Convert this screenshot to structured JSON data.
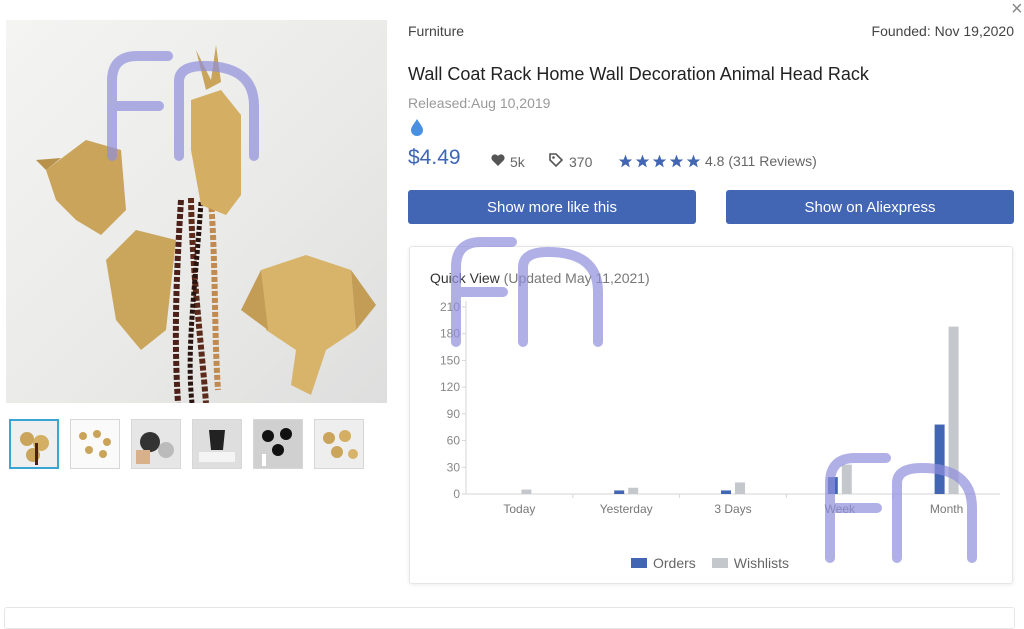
{
  "product": {
    "category": "Furniture",
    "founded": "Founded: Nov 19,2020",
    "title": "Wall Coat Rack Home Wall Decoration Animal Head Rack",
    "released": "Released:Aug 10,2019",
    "price": "$4.49",
    "likes": "5k",
    "tags": "370",
    "rating_text": "4.8 (311 Reviews)",
    "rating_value": 4.8,
    "buttons": {
      "more_like": "Show more like this",
      "aliexpress": "Show on Aliexpress"
    },
    "close_glyph": "×",
    "thumbnails_count": 6
  },
  "colors": {
    "accent": "#4266b4",
    "price": "#3d66b5",
    "orders": "#4266b4",
    "wishlists": "#c4c8cc",
    "watermark": "#8f8fdc"
  },
  "icons": [
    "close-icon",
    "drop-icon",
    "heart-icon",
    "tag-icon",
    "star-icon"
  ],
  "chart_data": {
    "type": "bar",
    "title": "Quick View",
    "subtitle": "(Updated May 11,2021)",
    "categories": [
      "Today",
      "Yesterday",
      "3 Days",
      "Week",
      "Month"
    ],
    "series": [
      {
        "name": "Orders",
        "values": [
          0,
          4,
          4,
          19,
          78
        ]
      },
      {
        "name": "Wishlists",
        "values": [
          5,
          7,
          13,
          33,
          188
        ]
      }
    ],
    "yticks": [
      0,
      30,
      60,
      90,
      120,
      150,
      180,
      210
    ],
    "ylim": [
      0,
      210
    ],
    "legend": "bottom",
    "grid": false
  }
}
